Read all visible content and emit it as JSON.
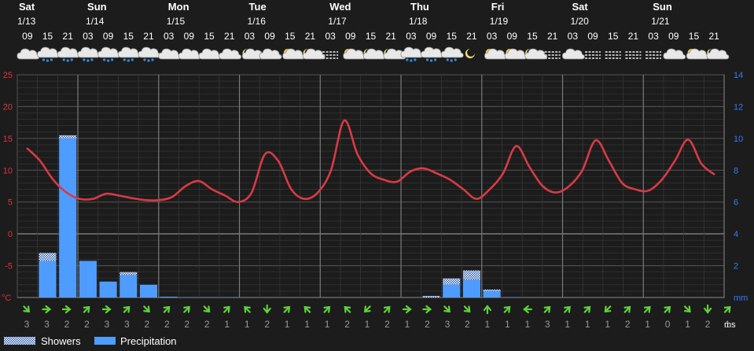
{
  "chart_data": {
    "type": "bar+line",
    "days": [
      {
        "name": "Sat",
        "date": "1/13"
      },
      {
        "name": "Sun",
        "date": "1/14"
      },
      {
        "name": "Mon",
        "date": "1/15"
      },
      {
        "name": "Tue",
        "date": "1/16"
      },
      {
        "name": "Wed",
        "date": "1/17"
      },
      {
        "name": "Thu",
        "date": "1/18"
      },
      {
        "name": "Fri",
        "date": "1/19"
      },
      {
        "name": "Sat",
        "date": "1/20"
      },
      {
        "name": "Sun",
        "date": "1/21"
      }
    ],
    "hours": [
      "09",
      "15",
      "21",
      "03",
      "09",
      "15",
      "21",
      "03",
      "09",
      "15",
      "21",
      "03",
      "09",
      "15",
      "21",
      "03",
      "09",
      "15",
      "21",
      "03",
      "09",
      "15",
      "21",
      "03",
      "09",
      "15",
      "21",
      "03",
      "09",
      "15",
      "21",
      "03",
      "09",
      "15",
      "21"
    ],
    "weather_icons": [
      "cloudy",
      "rain",
      "rain",
      "rain",
      "rain",
      "rain",
      "rain",
      "cloudy",
      "cloudy",
      "cloudy",
      "cloudy",
      "partly-cloudy-night",
      "cloudy",
      "partly-cloudy-day",
      "partly-cloudy-night",
      "fog",
      "partly-cloudy-day",
      "partly-cloudy-night",
      "partly-cloudy-night",
      "rain",
      "rain",
      "rain",
      "clear-night",
      "partly-cloudy-day",
      "partly-cloudy-day",
      "partly-cloudy-night",
      "fog",
      "cloudy",
      "fog",
      "fog",
      "fog",
      "fog",
      "cloudy",
      "partly-cloudy-day",
      "partly-cloudy-night"
    ],
    "temperature": [
      13.5,
      11.5,
      8.5,
      6.5,
      5.5,
      5.5,
      6.3,
      6.0,
      5.6,
      5.3,
      5.3,
      5.8,
      7.5,
      8.3,
      7.0,
      6.0,
      5.0,
      6.5,
      12.5,
      11.5,
      7.0,
      5.5,
      6.5,
      10.0,
      17.8,
      12.5,
      9.5,
      8.5,
      8.2,
      9.8,
      10.3,
      9.5,
      8.5,
      7.0,
      5.5,
      7.0,
      9.5,
      13.8,
      10.5,
      7.5,
      6.5,
      7.5,
      10.0,
      14.7,
      11.5,
      8.0,
      7.0,
      6.8,
      8.5,
      11.5,
      14.8,
      11.0,
      9.3
    ],
    "precipitation_mm": [
      0,
      2.3,
      10.0,
      2.3,
      1.0,
      1.4,
      0.8,
      0.05,
      0.02,
      0.02,
      0.02,
      0,
      0,
      0,
      0,
      0,
      0,
      0,
      0,
      0,
      0,
      0.8,
      1.1,
      0.4,
      0.02,
      0,
      0,
      0,
      0,
      0,
      0,
      0,
      0,
      0,
      0
    ],
    "showers_mm": [
      0,
      0.5,
      0.2,
      0,
      0,
      0.2,
      0,
      0,
      0,
      0,
      0,
      0,
      0,
      0,
      0,
      0,
      0,
      0,
      0,
      0,
      0.1,
      0.4,
      0.6,
      0.1,
      0,
      0,
      0,
      0,
      0,
      0,
      0,
      0,
      0,
      0,
      0
    ],
    "wind_dir": [
      "SE",
      "E",
      "E",
      "NE",
      "E",
      "NE",
      "SE",
      "NE",
      "NE",
      "SE",
      "NE",
      "NW",
      "S",
      "NE",
      "NW",
      "NE",
      "NW",
      "SW",
      "NE",
      "E",
      "E",
      "SE",
      "SE",
      "N",
      "NE",
      "W",
      "NE",
      "NE",
      "NE",
      "SW",
      "NE",
      "NE",
      "NE",
      "SE",
      "S",
      "NE"
    ],
    "wind_speed": [
      3,
      3,
      2,
      2,
      3,
      3,
      2,
      2,
      2,
      2,
      1,
      1,
      2,
      1,
      1,
      1,
      2,
      1,
      2,
      1,
      2,
      3,
      2,
      1,
      1,
      1,
      3,
      1,
      1,
      1,
      2,
      1,
      0,
      1,
      2,
      1
    ],
    "yleft": {
      "ticks": [
        25,
        20,
        15,
        10,
        5,
        0,
        -5
      ],
      "unit": "°C",
      "min": -10,
      "max": 25
    },
    "yright": {
      "ticks": [
        14,
        12,
        10,
        8,
        6,
        4,
        2
      ],
      "unit": "mm",
      "min": 0,
      "max": 14
    },
    "wind_unit": "ms",
    "legend": [
      {
        "name": "Showers",
        "style": "hatched"
      },
      {
        "name": "Precipitation",
        "color": "#4f9cff"
      }
    ]
  }
}
